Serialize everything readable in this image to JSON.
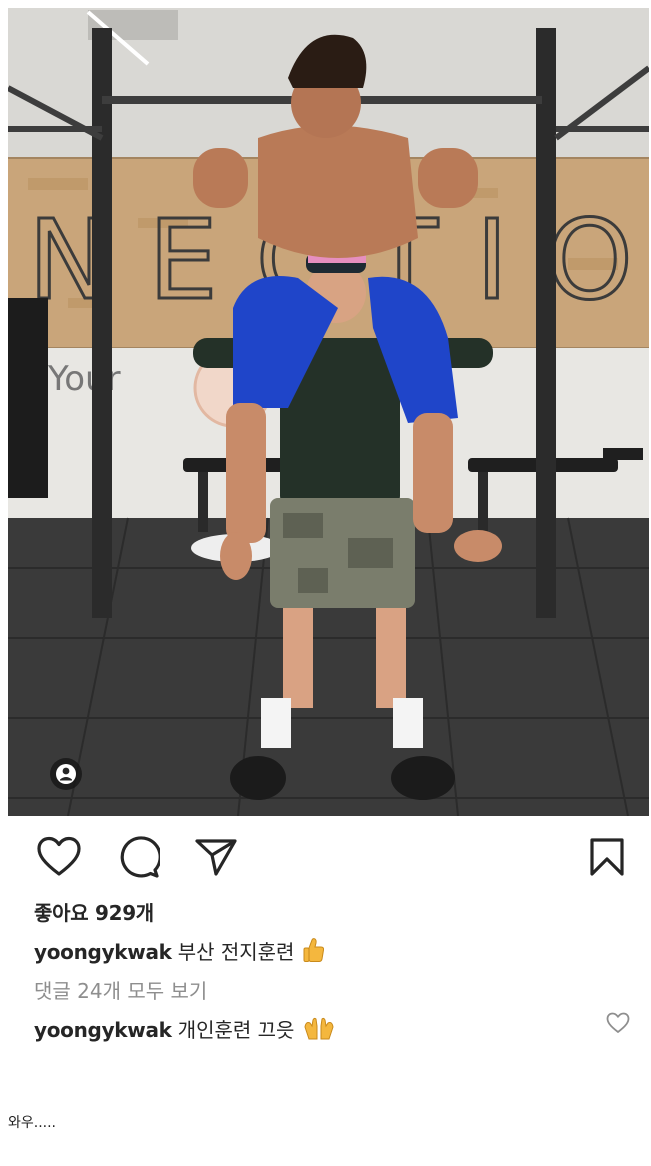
{
  "post": {
    "photo_alt": "gym photo",
    "wall_text": "Your",
    "wall_sign": "NECTIO",
    "icons": {
      "like": "heart-icon",
      "comment": "comment-icon",
      "share": "send-icon",
      "save": "bookmark-icon",
      "tag": "user-tag-icon"
    }
  },
  "likes": {
    "label": "좋아요 929개"
  },
  "caption": {
    "username": "yoongykwak",
    "text": "부산 전지훈련",
    "emoji": "thumbs-up"
  },
  "comments": {
    "view_all": "댓글 24개 모두 보기",
    "first": {
      "username": "yoongykwak",
      "text": "개인훈련 끄읏",
      "emoji": "raised-hands"
    }
  },
  "footer": {
    "text": "와우....."
  },
  "colors": {
    "text": "#262626",
    "muted": "#8e8e8e",
    "background": "#ffffff"
  }
}
